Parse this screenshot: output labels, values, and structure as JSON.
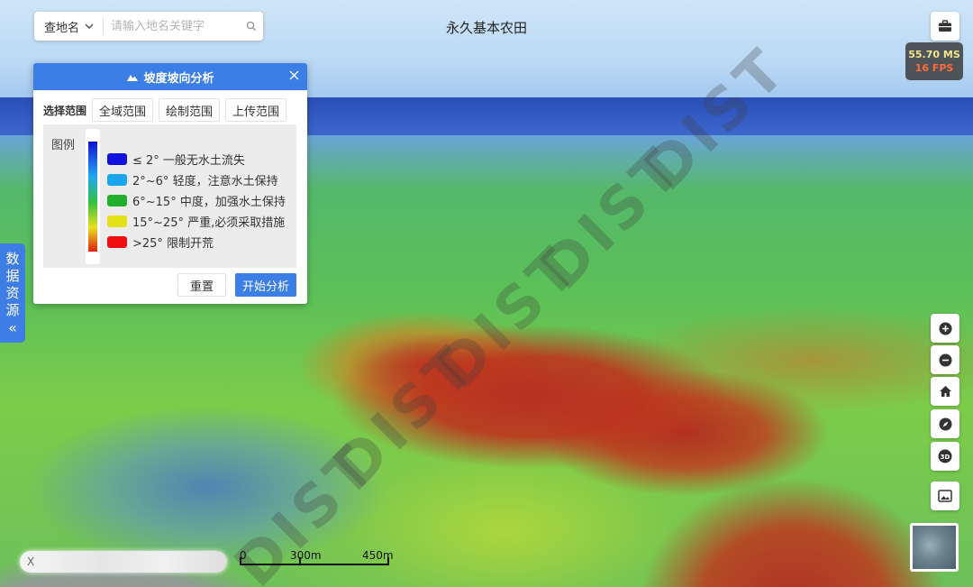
{
  "search": {
    "mode_label": "查地名",
    "placeholder": "请输入地名关键字"
  },
  "map": {
    "title": "永久基本农田",
    "watermark": "DIST"
  },
  "perf": {
    "ms": "55.70 MS",
    "fps": "16 FPS"
  },
  "sidetab": {
    "chars": [
      "数",
      "据",
      "资",
      "源"
    ],
    "arrow": "«"
  },
  "panel": {
    "title": "坡度坡向分析",
    "range_label": "选择范围",
    "range_buttons": [
      "全域范围",
      "绘制范围",
      "上传范围"
    ],
    "legend_title": "图例",
    "legend": [
      {
        "label": "≤ 2° 一般无水土流失",
        "color": "#1212e0"
      },
      {
        "label": "2°~6° 轻度，注意水土保持",
        "color": "#1aa6ee"
      },
      {
        "label": "6°~15° 中度，加强水土保持",
        "color": "#22b02c"
      },
      {
        "label": "15°~25° 严重,必须采取措施",
        "color": "#e4e018"
      },
      {
        "label": ">25° 限制开荒",
        "color": "#ee1010"
      }
    ],
    "reset_label": "重置",
    "start_label": "开始分析"
  },
  "coord": {
    "text": "X"
  },
  "scale": {
    "labels": [
      "0",
      "300m",
      "450m"
    ]
  },
  "colors": {
    "accent": "#3a7ee6"
  }
}
